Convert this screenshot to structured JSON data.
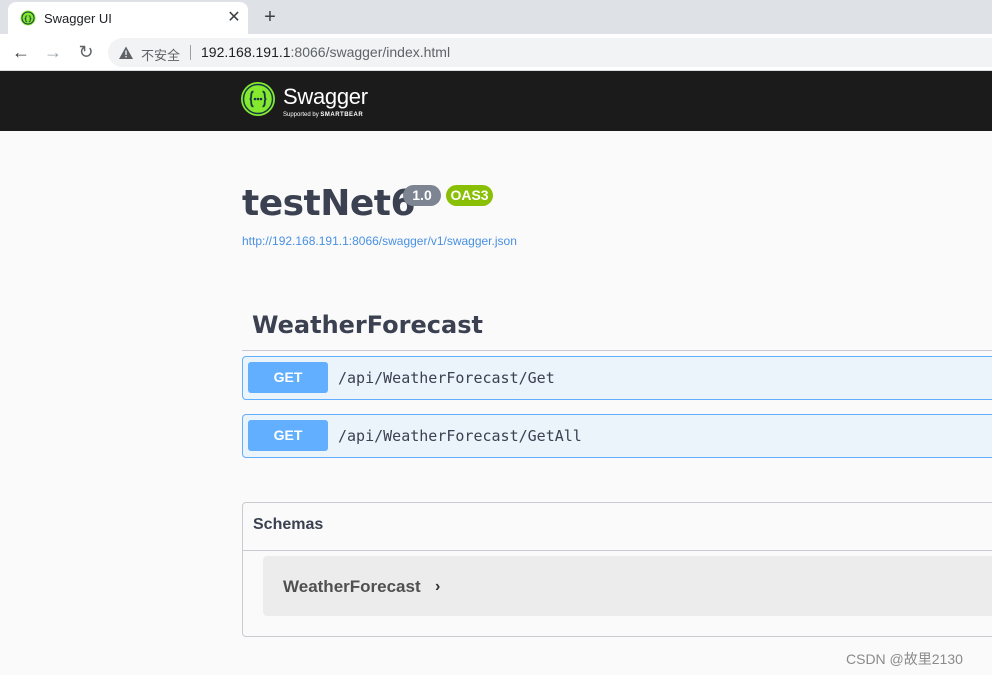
{
  "browser": {
    "tab": {
      "title": "Swagger UI",
      "close_label": "✕"
    },
    "new_tab_label": "+",
    "nav": {
      "back": "←",
      "forward": "→",
      "reload": "↻"
    },
    "address": {
      "security_label": "不安全",
      "url_host": "192.168.191.1",
      "url_rest": ":8066/swagger/index.html"
    }
  },
  "topbar": {
    "logo_text": "Swagger",
    "logo_sub_prefix": "Supported by ",
    "logo_sub_brand": "SMARTBEAR",
    "brand_color": "#85ea2d"
  },
  "info": {
    "title": "testNet6",
    "version": "1.0",
    "oas": "OAS3",
    "spec_url": "http://192.168.191.1:8066/swagger/v1/swagger.json"
  },
  "tag": {
    "name": "WeatherForecast",
    "operations": [
      {
        "method": "GET",
        "path": "/api/WeatherForecast/Get"
      },
      {
        "method": "GET",
        "path": "/api/WeatherForecast/GetAll"
      }
    ]
  },
  "schemas": {
    "title": "Schemas",
    "models": [
      {
        "name": "WeatherForecast",
        "chevron": "›"
      }
    ]
  },
  "watermark": "CSDN @故里2130",
  "colors": {
    "get": "#61affe",
    "get_bg": "#ebf3fb",
    "oas": "#89bf04",
    "version": "#7d8492"
  }
}
